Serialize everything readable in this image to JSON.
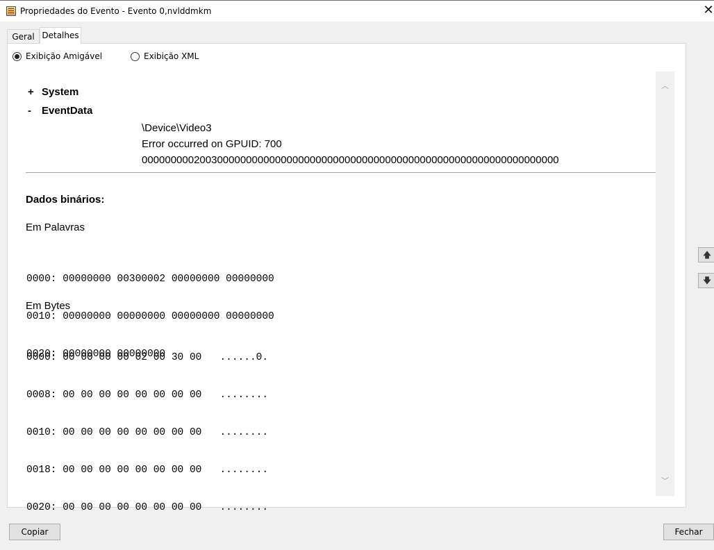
{
  "window": {
    "title": "Propriedades do Evento - Evento 0,nvlddmkm",
    "close_glyph": "✕"
  },
  "tabs": [
    {
      "label": "Geral",
      "active": false
    },
    {
      "label": "Detalhes",
      "active": true
    }
  ],
  "view_options": {
    "friendly": {
      "label": "Exibição Amigável",
      "checked": true
    },
    "xml": {
      "label": "Exibição XML",
      "checked": false
    }
  },
  "tree": {
    "system": {
      "sign": "+",
      "label": "System"
    },
    "eventdata": {
      "sign": "-",
      "label": "EventData"
    }
  },
  "event_data": [
    "\\Device\\Video3",
    "Error occurred on GPUID: 700",
    "000000000200300000000000000000000000000000000000000000000000000000000000"
  ],
  "binary": {
    "title": "Dados binários:",
    "words_label": "Em Palavras",
    "words": [
      "0000: 00000000 00300002 00000000 00000000",
      "0010: 00000000 00000000 00000000 00000000",
      "0020: 00000000 00000000"
    ],
    "bytes_label": "Em Bytes",
    "bytes": [
      "0000: 00 00 00 00 02 00 30 00   ......0.",
      "0008: 00 00 00 00 00 00 00 00   ........",
      "0010: 00 00 00 00 00 00 00 00   ........",
      "0018: 00 00 00 00 00 00 00 00   ........",
      "0020: 00 00 00 00 00 00 00 00   ........"
    ]
  },
  "scroll": {
    "up_glyph": "︿",
    "down_glyph": "﹀"
  },
  "side_buttons": {
    "up_glyph": "🡅",
    "down_glyph": "🡇"
  },
  "buttons": {
    "copy": "Copiar",
    "close": "Fechar"
  }
}
